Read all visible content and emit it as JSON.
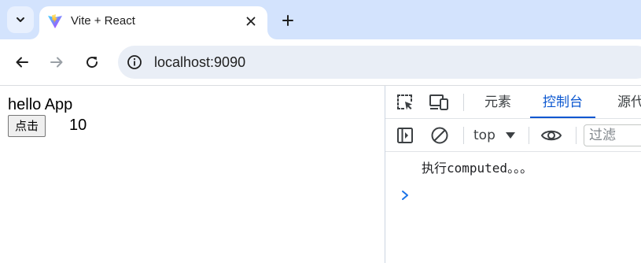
{
  "browser": {
    "tab": {
      "title": "Vite + React",
      "favicon": "vite-logo-icon"
    },
    "icons": {
      "tab_search": "chevron-down-icon",
      "close": "close-icon",
      "new_tab": "plus-icon",
      "back": "arrow-left-icon",
      "forward": "arrow-right-icon",
      "reload": "reload-icon",
      "site_info": "info-icon"
    },
    "address": {
      "url": "localhost:9090"
    },
    "colors": {
      "tabstrip_bg": "#d3e3fd",
      "omnibox_bg": "#e9eef6",
      "active_accent": "#0b57d0"
    }
  },
  "page": {
    "heading": "hello App",
    "button_label": "点击",
    "count": "10"
  },
  "devtools": {
    "tabs": [
      {
        "label": "元素",
        "active": false
      },
      {
        "label": "控制台",
        "active": true
      },
      {
        "label": "源代",
        "active": false
      }
    ],
    "toolbar": {
      "context": "top",
      "filter_placeholder": "过滤"
    },
    "console": {
      "messages": [
        "执行computed。。。"
      ]
    },
    "icons": {
      "inspect": "inspect-element-icon",
      "device": "device-toolbar-icon",
      "sidebar": "sidebar-toggle-icon",
      "clear": "clear-console-icon",
      "dropdown": "caret-down-icon",
      "live_expression": "eye-icon",
      "prompt": "chevron-right-icon"
    }
  }
}
